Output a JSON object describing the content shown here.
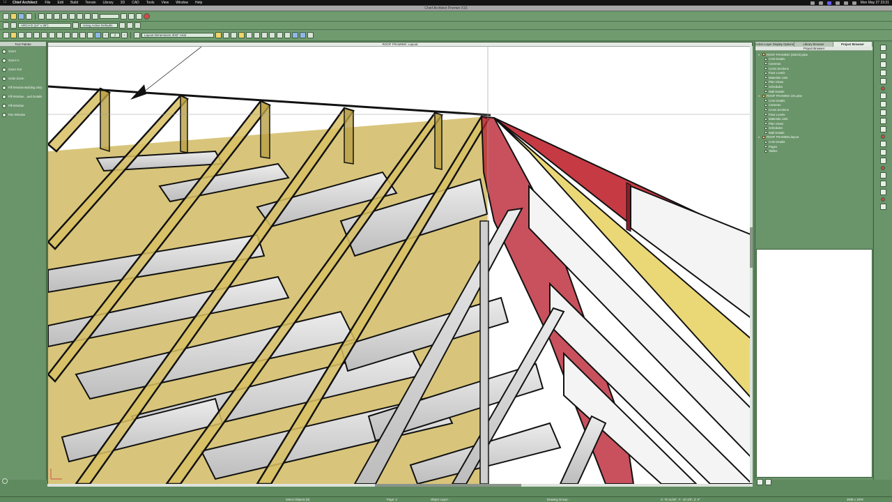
{
  "menubar": {
    "app": "Chief Architect",
    "items": [
      "File",
      "Edit",
      "Build",
      "Terrain",
      "Library",
      "3D",
      "CAD",
      "Tools",
      "View",
      "Window",
      "Help"
    ],
    "clock": "Mon May 27 23:31"
  },
  "window": {
    "title": "Chief Architect Premier X16"
  },
  "toolbar2": {
    "layout_select": "ARCH D (24\" x 36\")",
    "defaults_select": "Using Active Defaults"
  },
  "toolbar3": {
    "page_number": "2",
    "layer_select": "Layout Dimensions 3/32\" Arial"
  },
  "tool_palette": {
    "title": "Tool Palette",
    "items": [
      {
        "label": "Zoom",
        "icon": "zoom-icon"
      },
      {
        "label": "Zoom In",
        "icon": "zoom-in-icon"
      },
      {
        "label": "Zoom Out",
        "icon": "zoom-out-icon"
      },
      {
        "label": "Undo Zoom",
        "icon": "undo-zoom-icon"
      },
      {
        "label": "Fill Window Building Only",
        "icon": "fill-window-building-icon"
      },
      {
        "label": "Fill Window ...ued Details",
        "icon": "fill-window-details-icon"
      },
      {
        "label": "Fill Window",
        "icon": "fill-window-icon"
      },
      {
        "label": "Pan Window",
        "icon": "pan-window-icon"
      }
    ]
  },
  "canvas": {
    "title": "ROOF FRAMING: Layout"
  },
  "right_panel": {
    "tabs": [
      "Active Layer Display Options",
      "Library Browser",
      "Project Browser"
    ],
    "active_tab": "Project Browser",
    "header": "Project Browser",
    "tree": [
      {
        "label": "ROOF FRAMING (GBGS).plan",
        "children": [
          "CAD Details",
          "Cameras",
          "Cross Sections",
          "Floor Levels",
          "Materials Lists",
          "Plan Views",
          "Schedules",
          "Wall Details"
        ]
      },
      {
        "label": "ROOF FRAMING 101.plan",
        "children": [
          "CAD Details",
          "Cameras",
          "Cross Sections",
          "Floor Levels",
          "Materials Lists",
          "Plan Views",
          "Schedules",
          "Wall Details"
        ]
      },
      {
        "label": "ROOF FRAMING.layout",
        "children": [
          "CAD Details",
          "Pages",
          "Tables"
        ]
      }
    ]
  },
  "status": {
    "select": "Select Objects [S]",
    "page": "Page: 2",
    "object_layer": "Object Layer: -",
    "drawing_group": "Drawing Group: -",
    "coords": "X: 76 11/16\", Y: -10 1/8\", Z: 0\"",
    "size": "3838 x 1878"
  },
  "colors": {
    "rafter_yellow": "#d8c063",
    "valley_red": "#c63a44",
    "joist_gray": "#d6d6d6",
    "panel_green": "#6a946a"
  }
}
